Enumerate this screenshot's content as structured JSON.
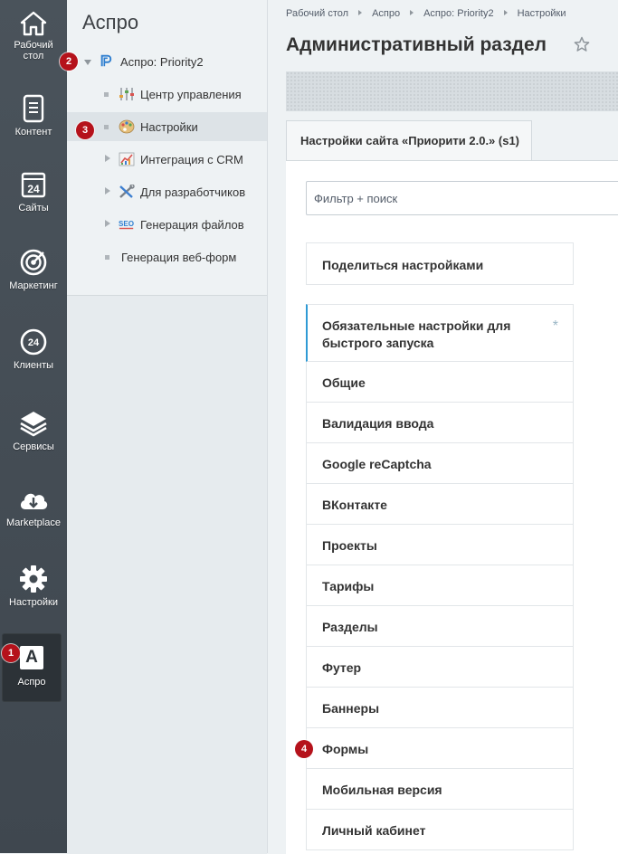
{
  "sidebar": {
    "items": [
      {
        "label": "Рабочий стол",
        "icon": "home-icon"
      },
      {
        "label": "Контент",
        "icon": "document-icon"
      },
      {
        "label": "Сайты",
        "icon": "calendar-24-icon"
      },
      {
        "label": "Маркетинг",
        "icon": "target-icon"
      },
      {
        "label": "Клиенты",
        "icon": "clients-24-icon"
      },
      {
        "label": "Сервисы",
        "icon": "layers-icon"
      },
      {
        "label": "Marketplace",
        "icon": "cloud-download-icon"
      },
      {
        "label": "Настройки",
        "icon": "gear-icon"
      },
      {
        "label": "Аспро",
        "icon_letter": "A",
        "active": true
      }
    ]
  },
  "tree": {
    "title": "Аспро",
    "root": {
      "label": "Аспро: Priority2",
      "expanded": true
    },
    "items": [
      {
        "label": "Центр управления",
        "icon": "equalizer-icon"
      },
      {
        "label": "Настройки",
        "icon": "palette-icon",
        "selected": true
      },
      {
        "label": "Интеграция с CRM",
        "icon": "chart-icon",
        "has_children": true
      },
      {
        "label": "Для разработчиков",
        "icon": "tools-icon",
        "has_children": true
      },
      {
        "label": "Генерация файлов",
        "icon": "seo-icon",
        "has_children": true
      },
      {
        "label": "Генерация веб-форм"
      }
    ]
  },
  "breadcrumbs": [
    "Рабочий стол",
    "Аспро",
    "Аспро: Priority2",
    "Настройки"
  ],
  "page_title": "Административный раздел",
  "tab_label": "Настройки сайта «Приорити 2.0.» (s1)",
  "search": {
    "placeholder": "Фильтр + поиск"
  },
  "share_label": "Поделиться настройками",
  "settings_menu": {
    "first": {
      "label": "Обязательные настройки для быстрого запуска",
      "mark": "*"
    },
    "items": [
      "Общие",
      "Валидация ввода",
      "Google reCaptcha",
      "ВКонтакте",
      "Проекты",
      "Тарифы",
      "Разделы",
      "Футер",
      "Баннеры",
      "Формы",
      "Мобильная версия",
      "Личный кабинет"
    ]
  },
  "markers": [
    "1",
    "2",
    "3",
    "4"
  ],
  "colors": {
    "sidebar": "#434b52",
    "accent": "#2f9ad5",
    "marker": "#b5121b"
  }
}
